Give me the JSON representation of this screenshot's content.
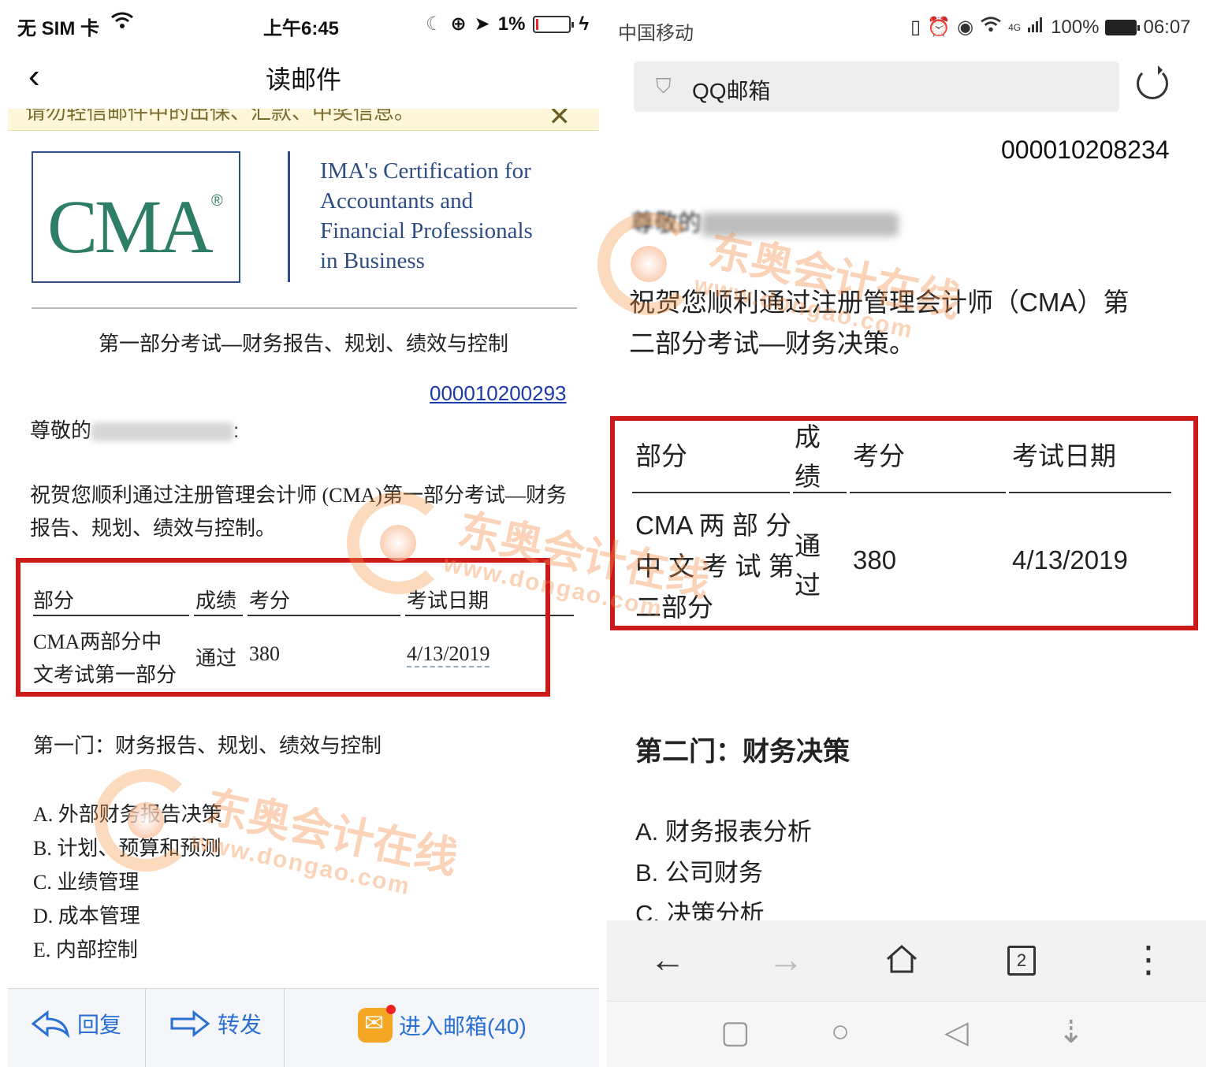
{
  "left": {
    "status": {
      "carrier": "无 SIM 卡",
      "time": "上午6:45",
      "battery": "1%"
    },
    "nav": {
      "title": "读邮件"
    },
    "warning": {
      "text": "请勿轻信邮件中的出保、汇款、中奖信息。"
    },
    "brand": {
      "logo": "CMA",
      "registered": "®",
      "tagline": [
        "IMA's Certification for",
        "Accountants and",
        "Financial Professionals",
        "in Business"
      ]
    },
    "exam_title": "第一部分考试—财务报告、规划、绩效与控制",
    "reference_number": "000010200293",
    "greeting_prefix": "尊敬的",
    "greeting_suffix": ":",
    "congrats": "祝贺您顺利通过注册管理会计师 (CMA)第一部分考试—财务报告、规划、绩效与控制。",
    "table": {
      "headers": [
        "部分",
        "成绩",
        "考分",
        "考试日期"
      ],
      "row": {
        "part_line1": "CMA两部分中",
        "part_line2": "文考试第一部分",
        "result": "通过",
        "score": "380",
        "date": "4/13/2019"
      }
    },
    "subject": "第一门：财务报告、规划、绩效与控制",
    "topics": [
      "A. 外部财务报告决策",
      "B. 计划、预算和预测",
      "C. 业绩管理",
      "D. 成本管理",
      "E. 内部控制"
    ],
    "toolbar": {
      "reply": "回复",
      "forward": "转发",
      "inbox": "进入邮箱(40)"
    }
  },
  "right": {
    "status": {
      "carrier": "中国移动",
      "battery": "100%",
      "time": "06:07",
      "network": "4G"
    },
    "url_title": "QQ邮箱",
    "reference_number": "000010208234",
    "greeting_prefix": "尊敬的",
    "congrats_line1": "祝贺您顺利通过注册管理会计师（CMA）第",
    "congrats_line2": "二部分考试—财务决策。",
    "table": {
      "headers": [
        "部分",
        "成绩",
        "考分",
        "考试日期"
      ],
      "header_result_line1": "成",
      "header_result_line2": "绩",
      "row": {
        "part_line1": "CMA 两 部 分",
        "part_line2": "中 文 考 试 第",
        "part_line3": "二部分",
        "result_line1": "通",
        "result_line2": "过",
        "score": "380",
        "date": "4/13/2019"
      }
    },
    "subject": "第二门：财务决策",
    "topics": [
      "A. 财务报表分析",
      "B. 公司财务",
      "C. 决策分析"
    ],
    "tab_count": "2"
  },
  "watermark": {
    "cn": "东奥会计在线",
    "url": "www.dongao.com"
  }
}
